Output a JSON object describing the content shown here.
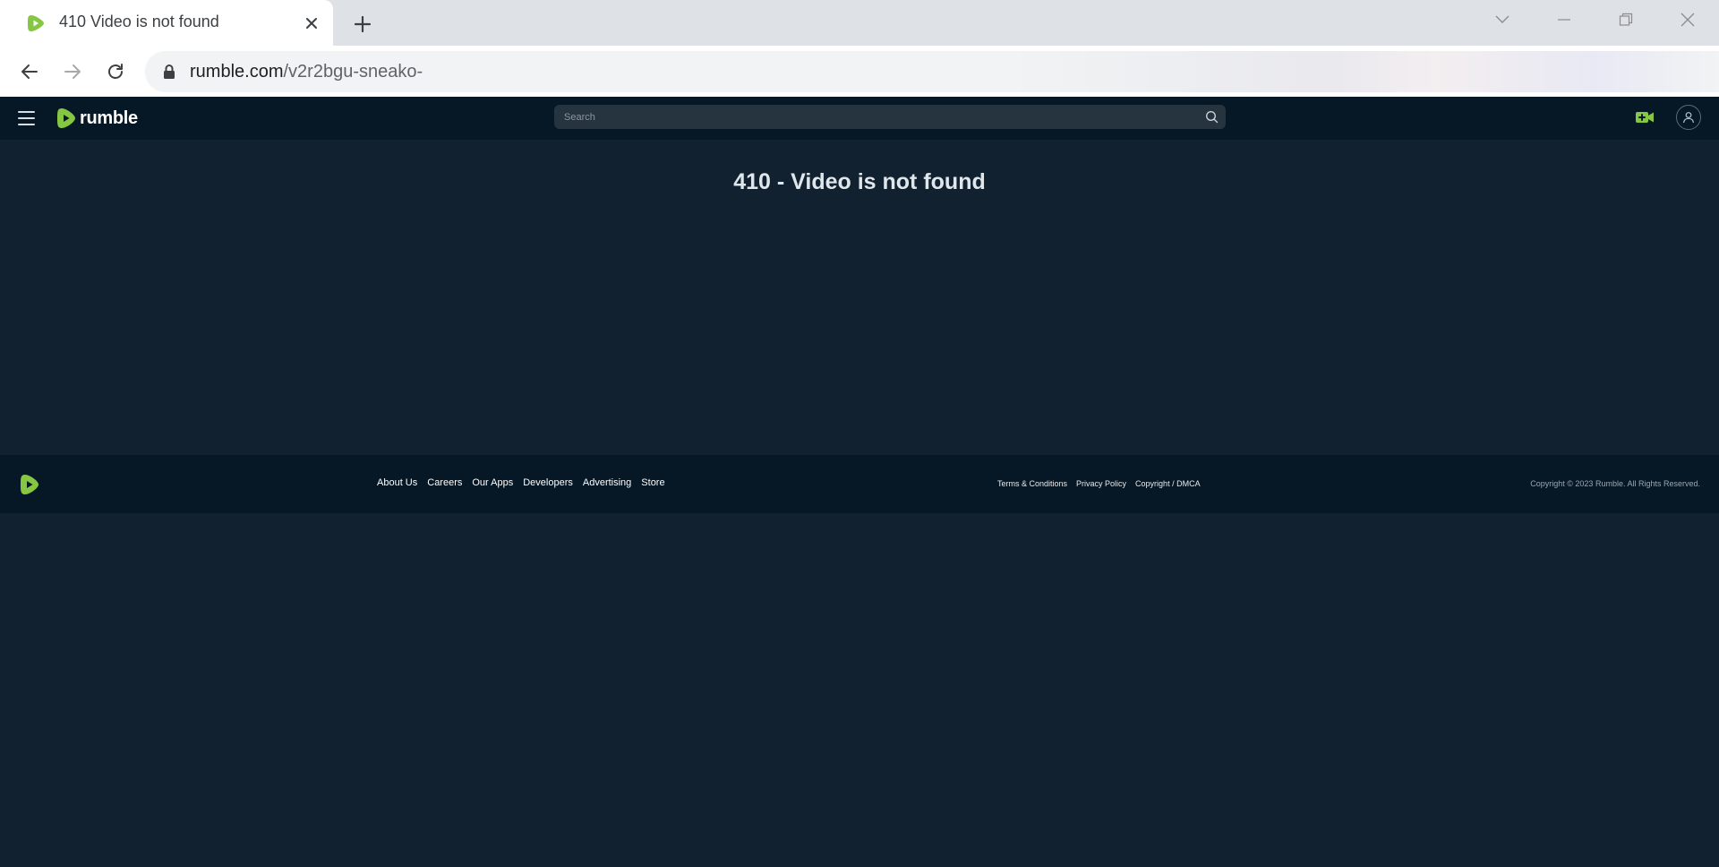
{
  "browser": {
    "tab": {
      "title": "410 Video is not found"
    },
    "address": {
      "host": "rumble.com",
      "path": "/v2r2bgu-sneako-"
    }
  },
  "header": {
    "logo_text": "rumble",
    "search": {
      "placeholder": "Search"
    }
  },
  "main": {
    "title": "410 - Video is not found"
  },
  "footer": {
    "links": [
      "About Us",
      "Careers",
      "Our Apps",
      "Developers",
      "Advertising",
      "Store"
    ],
    "legal": [
      "Terms & Conditions",
      "Privacy Policy",
      "Copyright / DMCA"
    ],
    "copyright": "Copyright © 2023 Rumble. All Rights Reserved."
  },
  "colors": {
    "brand_green": "#85c742",
    "header_bg": "#061725",
    "page_bg": "#112130"
  },
  "icons": {
    "favicon": "rumble-play-icon",
    "tab_close": "close-icon",
    "new_tab": "plus-icon",
    "back": "arrow-left-icon",
    "forward": "arrow-right-icon",
    "reload": "reload-icon",
    "lock": "lock-icon",
    "menu": "hamburger-icon",
    "search": "search-icon",
    "upload": "video-plus-icon",
    "account": "user-icon"
  }
}
